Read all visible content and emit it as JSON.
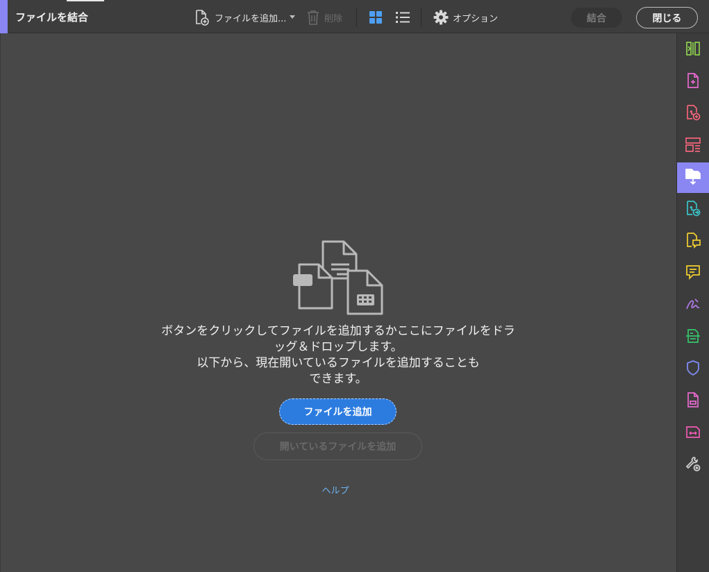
{
  "window": {
    "title": "ファイルを結合"
  },
  "toolbar": {
    "add_files_label": "ファイルを追加...",
    "delete_label": "削除",
    "options_label": "オプション",
    "combine_label": "結合",
    "close_label": "閉じる",
    "icons": [
      "add-file-icon",
      "dropdown-caret-icon",
      "trash-icon",
      "grid-view-icon",
      "list-view-icon",
      "gear-icon"
    ]
  },
  "main": {
    "message_lines": [
      "ボタンをクリックしてファイルを追加するかここにファイルをドラ",
      "ッグ＆ドロップします。",
      "以下から、現在開いているファイルを追加することも",
      "できます。"
    ],
    "add_files_button": "ファイルを追加",
    "add_open_files_button": "開いているファイルを追加",
    "help_link": "ヘルプ"
  },
  "right_rail": {
    "active_index": 4,
    "tools": [
      "compare-files-icon",
      "create-pdf-icon",
      "export-pdf-icon",
      "organize-pages-icon",
      "combine-files-icon",
      "send-for-review-icon",
      "comment-file-icon",
      "comment-icon",
      "fill-sign-icon",
      "scan-ocr-icon",
      "protect-icon",
      "print-production-icon",
      "redact-icon",
      "more-tools-icon"
    ]
  },
  "colors": {
    "accent": "#8a86f2",
    "primary_button": "#2c7ce0",
    "link": "#6fb3f2",
    "background": "#484848",
    "toolbar": "#3d3d3d"
  }
}
